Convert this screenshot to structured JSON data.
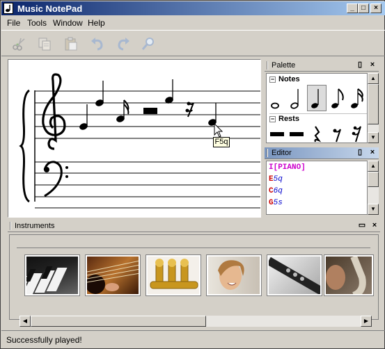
{
  "window": {
    "title": "Music NotePad",
    "min_glyph": "_",
    "max_glyph": "□",
    "close_glyph": "×"
  },
  "menu": [
    {
      "label": "File"
    },
    {
      "label": "Tools"
    },
    {
      "label": "Window"
    },
    {
      "label": "Help"
    }
  ],
  "toolbar": {
    "buttons": [
      {
        "name": "cut",
        "icon": "scissors-icon"
      },
      {
        "name": "copy",
        "icon": "copy-icon"
      },
      {
        "name": "paste",
        "icon": "paste-icon"
      },
      {
        "name": "undo",
        "icon": "undo-icon"
      },
      {
        "name": "redo",
        "icon": "redo-icon"
      },
      {
        "name": "find",
        "icon": "magnifier-icon"
      }
    ]
  },
  "score": {
    "tooltip": "F5q"
  },
  "palette": {
    "title": "Palette",
    "notes_label": "Notes",
    "rests_label": "Rests",
    "notes": [
      "whole",
      "half",
      "quarter",
      "eighth",
      "sixteenth"
    ],
    "rests": [
      "whole-rest",
      "half-rest",
      "quarter-rest",
      "eighth-rest",
      "sixteenth-rest"
    ],
    "selected_note": "quarter"
  },
  "editor": {
    "title": "Editor",
    "lines": [
      {
        "first": "I",
        "rest": "[PIANO]",
        "first_color": "#cc00cc",
        "rest_color": "#cc00cc"
      },
      {
        "first": "E",
        "rest": "5q",
        "first_color": "#cc0000",
        "rest_color": "#0000cc"
      },
      {
        "first": "C",
        "rest": "6q",
        "first_color": "#cc0000",
        "rest_color": "#0000cc"
      },
      {
        "first": "G",
        "rest": "5s",
        "first_color": "#cc0000",
        "rest_color": "#0000cc"
      }
    ]
  },
  "instruments": {
    "title": "Instruments",
    "items": [
      "piano",
      "guitar",
      "trumpet",
      "voice",
      "clarinet",
      "saxophone"
    ]
  },
  "status": {
    "text": "Successfully played!"
  }
}
